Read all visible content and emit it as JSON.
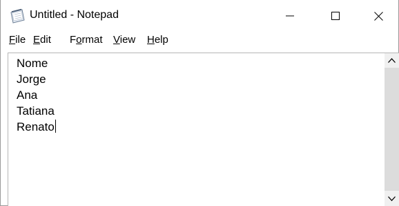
{
  "window": {
    "title": "Untitled - Notepad",
    "controls": {
      "minimize_icon": "minimize-icon",
      "maximize_icon": "maximize-icon",
      "close_icon": "close-icon"
    }
  },
  "menu": {
    "items": [
      {
        "label": "File",
        "mnemonic": "F",
        "rest": "ile"
      },
      {
        "label": "Edit",
        "mnemonic": "E",
        "rest": "dit"
      },
      {
        "label": "Format",
        "pre": "F",
        "mnemonic": "o",
        "rest": "rmat"
      },
      {
        "label": "View",
        "mnemonic": "V",
        "rest": "iew"
      },
      {
        "label": "Help",
        "mnemonic": "H",
        "rest": "elp"
      }
    ]
  },
  "editor": {
    "lines": [
      "Nome",
      "Jorge",
      "Ana",
      "Tatiana",
      "Renato"
    ]
  },
  "colors": {
    "scroll_track": "#dcdcdc",
    "border": "#9a9a9a"
  }
}
